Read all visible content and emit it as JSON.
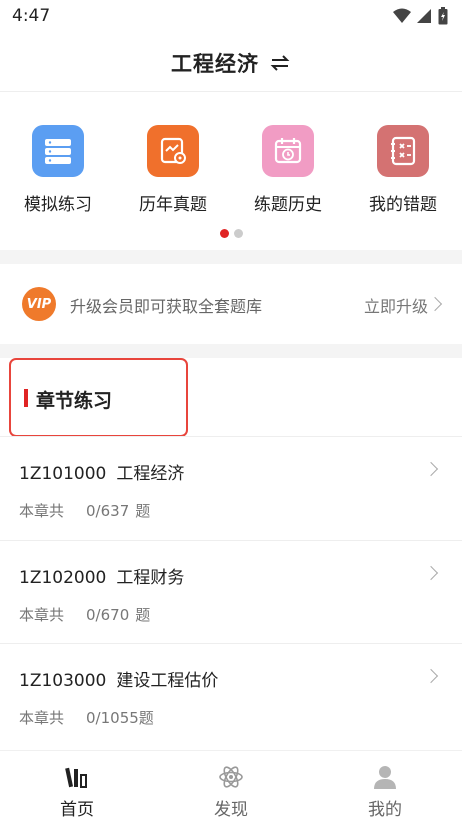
{
  "status_bar": {
    "time": "4:47"
  },
  "header": {
    "title": "工程经济"
  },
  "quick_actions": [
    {
      "label": "模拟练习",
      "color": "#5b9ef2"
    },
    {
      "label": "历年真题",
      "color": "#f0702c"
    },
    {
      "label": "练题历史",
      "color": "#f19cc4"
    },
    {
      "label": "我的错题",
      "color": "#d47272"
    }
  ],
  "pager": {
    "active_color": "#e02424",
    "inactive_color": "#cccccc"
  },
  "vip": {
    "badge": "VIP",
    "text": "升级会员即可获取全套题库",
    "action": "立即升级"
  },
  "section": {
    "title": "章节练习"
  },
  "chapters": [
    {
      "code": "1Z101000",
      "name": "工程经济",
      "prefix": "本章共",
      "count": "0/637",
      "unit": "题"
    },
    {
      "code": "1Z102000",
      "name": "工程财务",
      "prefix": "本章共",
      "count": "0/670",
      "unit": "题"
    },
    {
      "code": "1Z103000",
      "name": "建设工程估价",
      "prefix": "本章共",
      "count": "0/1055",
      "unit": "题"
    }
  ],
  "bottom_nav": [
    {
      "label": "首页",
      "active": true
    },
    {
      "label": "发现",
      "active": false
    },
    {
      "label": "我的",
      "active": false
    }
  ],
  "colors": {
    "accent": "#e02424",
    "highlight": "#e8453c"
  }
}
